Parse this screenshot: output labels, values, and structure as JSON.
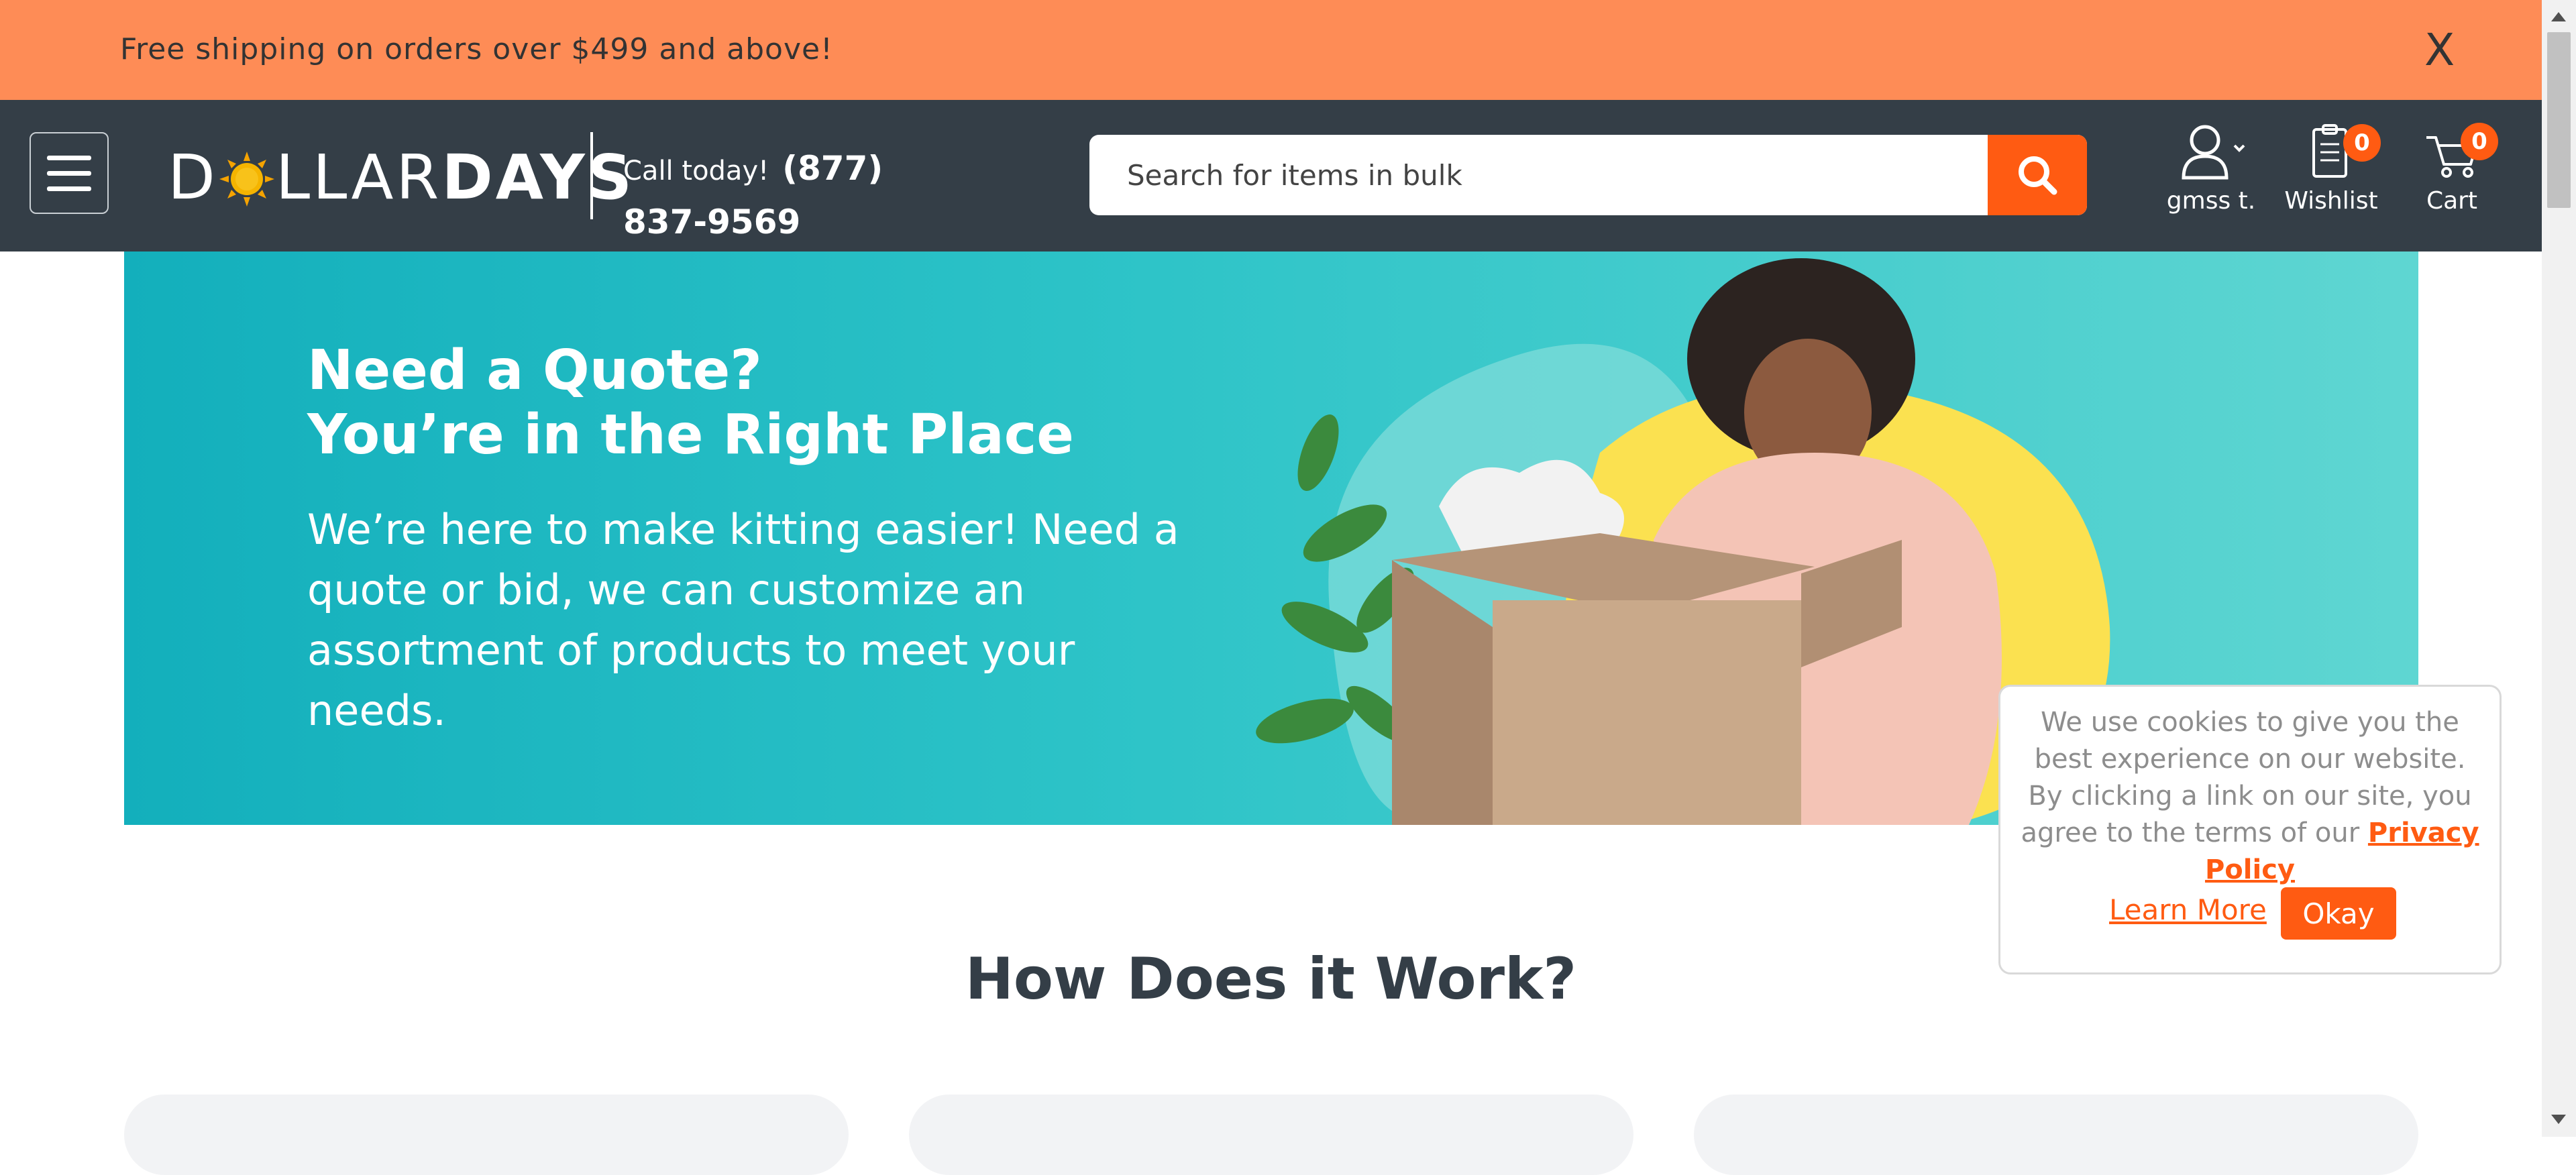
{
  "promo": {
    "text": "Free shipping on orders over $499 and above!",
    "close_label": "X"
  },
  "header": {
    "logo": {
      "part1_a": "D",
      "part1_b": "LLAR",
      "part2": "DAYS"
    },
    "call_label": "Call today!",
    "phone": "(877) 837-9569",
    "search_placeholder": "Search for items in bulk",
    "account_label": "gmss t.",
    "wishlist_label": "Wishlist",
    "wishlist_count": "0",
    "cart_label": "Cart",
    "cart_count": "0"
  },
  "hero": {
    "title_line1": "Need a Quote?",
    "title_line2": "You’re in the Right Place",
    "body": "We’re here to make kitting easier! Need a quote or bid, we can customize an assortment of products to meet your needs."
  },
  "how": {
    "title": "How Does it Work?"
  },
  "cookie": {
    "text": "We use cookies to give you the best experience on our website. By clicking a link on our site, you agree to the terms of our",
    "privacy_link": "Privacy Policy",
    "learn_more": "Learn More",
    "okay": "Okay"
  },
  "colors": {
    "accent": "#ff5b12",
    "promo_bg": "#fe8c56",
    "header_bg": "#343e47",
    "hero_bg": "#1fb9c2",
    "sun": "#f5b400"
  }
}
